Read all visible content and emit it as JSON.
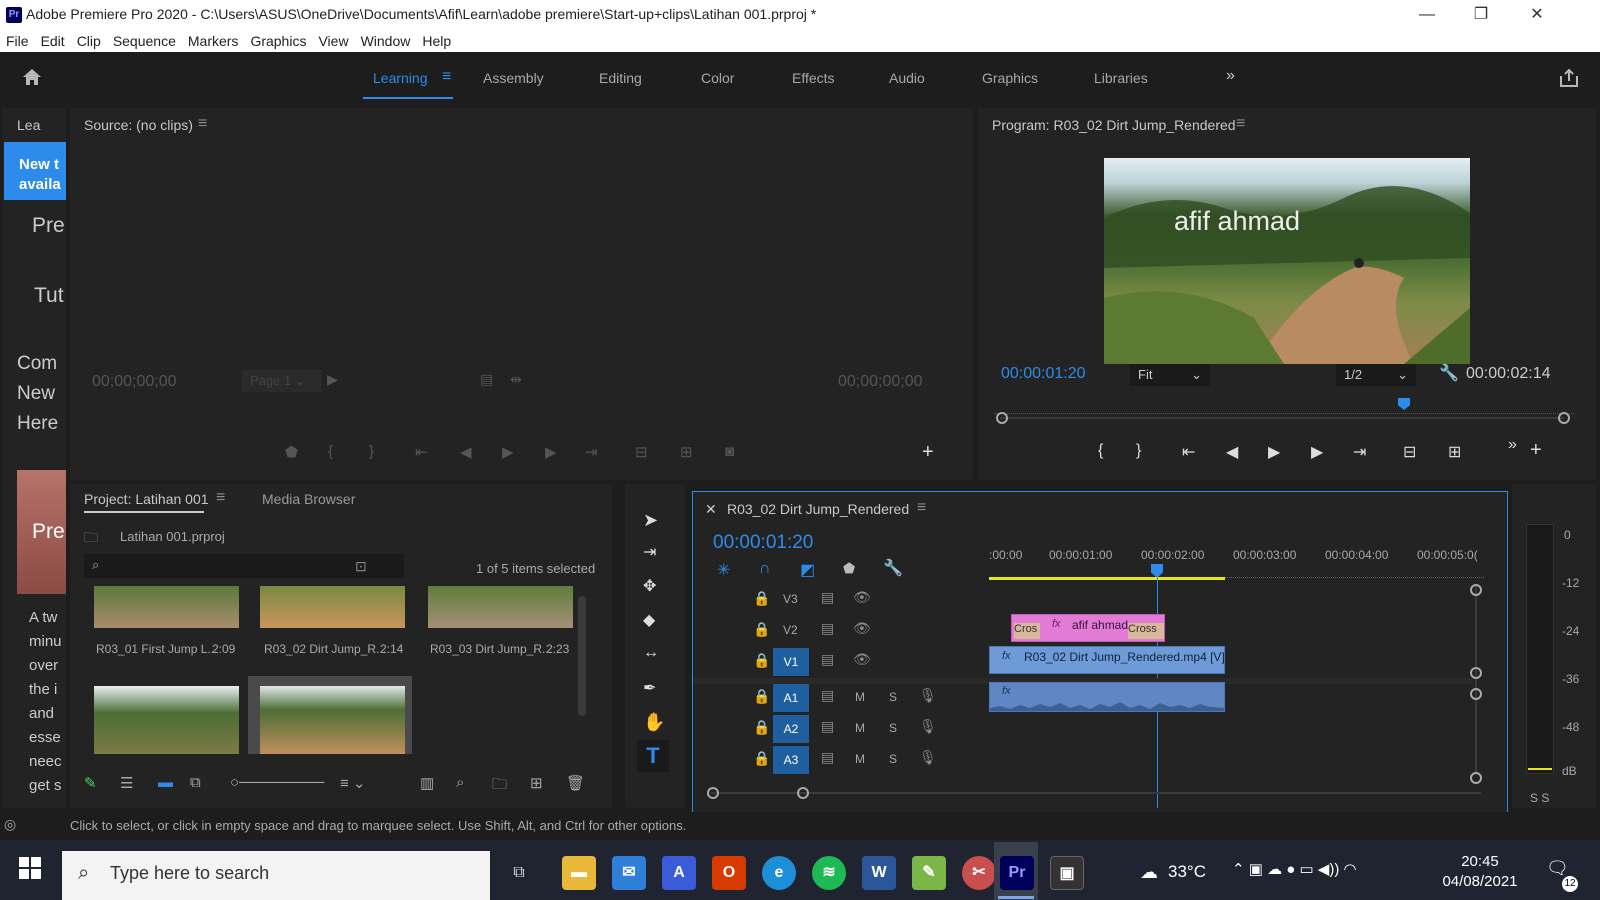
{
  "window": {
    "title": "Adobe Premiere Pro 2020 - C:\\Users\\ASUS\\OneDrive\\Documents\\Afif\\Learn\\adobe premiere\\Start-up+clips\\Latihan 001.prproj *",
    "app_badge": "Pr"
  },
  "menu": [
    "File",
    "Edit",
    "Clip",
    "Sequence",
    "Markers",
    "Graphics",
    "View",
    "Window",
    "Help"
  ],
  "workspaces": [
    "Learning",
    "Assembly",
    "Editing",
    "Color",
    "Effects",
    "Audio",
    "Graphics",
    "Libraries"
  ],
  "learn_panel": {
    "tab": "Lea",
    "banner_line1": "New t",
    "banner_line2": "availa",
    "lines": [
      "Pre",
      "Tut",
      "Com",
      "New",
      "Here"
    ],
    "thumb_text": "Pre",
    "body": [
      "A tw",
      "minu",
      "over",
      "the i",
      "and",
      "esse",
      "neec",
      "get s"
    ]
  },
  "source": {
    "title": "Source: (no clips)",
    "tc_left": "00;00;00;00",
    "tc_right": "00;00;00;00",
    "page": "Page 1"
  },
  "program": {
    "title": "Program: R03_02 Dirt Jump_Rendered",
    "overlay_text": "afif ahmad",
    "tc_current": "00:00:01:20",
    "tc_duration": "00:00:02:14",
    "fit": "Fit",
    "resolution": "1/2"
  },
  "project": {
    "tab": "Project: Latihan 001",
    "tab2": "Media Browser",
    "file": "Latihan 001.prproj",
    "selection": "1 of 5 items selected",
    "clips": [
      {
        "name": "R03_01 First Jump L...",
        "dur": "2:09"
      },
      {
        "name": "R03_02 Dirt Jump_R...",
        "dur": "2:14"
      },
      {
        "name": "R03_03 Dirt Jump_R...",
        "dur": "2:23"
      }
    ]
  },
  "timeline": {
    "title": "R03_02 Dirt Jump_Rendered",
    "tc": "00:00:01:20",
    "ruler": [
      ":00:00",
      "00:00:01:00",
      "00:00:02:00",
      "00:00:03:00",
      "00:00:04:00",
      "00:00:05:0("
    ],
    "tracks": [
      {
        "id": "V3",
        "type": "v"
      },
      {
        "id": "V2",
        "type": "v"
      },
      {
        "id": "V1",
        "type": "v"
      },
      {
        "id": "A1",
        "type": "a"
      },
      {
        "id": "A2",
        "type": "a"
      },
      {
        "id": "A3",
        "type": "a"
      }
    ],
    "clip_title": "afif ahmad",
    "clip_cross_l": "Cros",
    "clip_cross_r": "Cross",
    "clip_v1": "R03_02 Dirt Jump_Rendered.mp4 [V]",
    "fx": "fx",
    "mute": "M",
    "solo": "S"
  },
  "meter": {
    "ticks": [
      "0",
      "-12",
      "-24",
      "-36",
      "-48",
      "dB"
    ],
    "ss": "S S"
  },
  "status": "Click to select, or click in empty space and drag to marquee select. Use Shift, Alt, and Ctrl for other options.",
  "taskbar": {
    "search": "Type here to search",
    "temp": "33°C",
    "time": "20:45",
    "date": "04/08/2021",
    "notif": "12"
  },
  "colors": {
    "accent": "#2d8ceb",
    "premiere": "#9999ff",
    "titleclip": "#e17bd6",
    "videoclip": "#6f9ad8"
  }
}
